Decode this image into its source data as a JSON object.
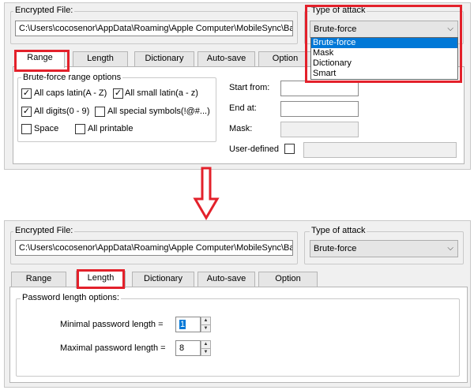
{
  "top": {
    "encrypted_label": "Encrypted File:",
    "file_path": "C:\\Users\\cocosenor\\AppData\\Roaming\\Apple Computer\\MobileSync\\Backu",
    "attack_label": "Type of attack",
    "attack_selected": "Brute-force",
    "attack_options": [
      "Brute-force",
      "Mask",
      "Dictionary",
      "Smart"
    ],
    "tabs": [
      "Range",
      "Length",
      "Dictionary",
      "Auto-save",
      "Option"
    ],
    "range_group_label": "Brute-force range options",
    "checkboxes": {
      "caps": {
        "label": "All caps latin(A - Z)",
        "checked": true
      },
      "small": {
        "label": "All small latin(a - z)",
        "checked": true
      },
      "digits": {
        "label": "All digits(0 - 9)",
        "checked": true
      },
      "special": {
        "label": "All special symbols(!@#...)",
        "checked": false
      },
      "space": {
        "label": "Space",
        "checked": false
      },
      "printable": {
        "label": "All printable",
        "checked": false
      }
    },
    "start_from_label": "Start from:",
    "end_at_label": "End at:",
    "mask_label": "Mask:",
    "user_defined_label": "User-defined"
  },
  "bottom": {
    "encrypted_label": "Encrypted File:",
    "file_path": "C:\\Users\\cocosenor\\AppData\\Roaming\\Apple Computer\\MobileSync\\Backu",
    "attack_label": "Type of attack",
    "attack_selected": "Brute-force",
    "tabs": [
      "Range",
      "Length",
      "Dictionary",
      "Auto-save",
      "Option"
    ],
    "length_group_label": "Password length options:",
    "min_label": "Minimal password length =",
    "min_value": "1",
    "max_label": "Maximal password length =",
    "max_value": "8"
  },
  "check_glyph": "✓",
  "colors": {
    "highlight_red": "#e3212b",
    "selection_blue": "#0078d7"
  }
}
